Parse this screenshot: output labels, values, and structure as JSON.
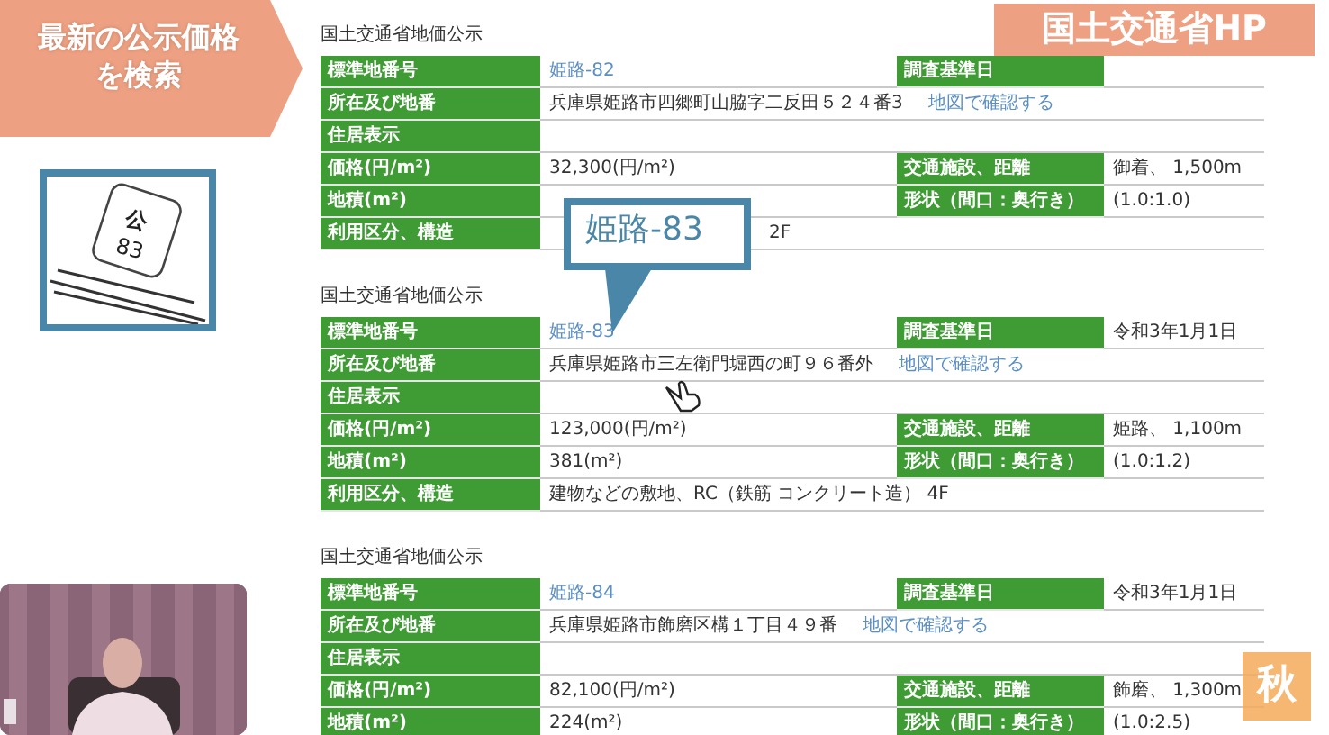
{
  "side_banner": {
    "lines": [
      "最新の公示価格",
      "を検索"
    ]
  },
  "plate_illustration": {
    "kanji": "公",
    "number": "83"
  },
  "hp_banner": "国土交通省HP",
  "callout": "姫路-83",
  "corner_badge": "秋",
  "records": [
    {
      "title": "国土交通省地価公示",
      "rows": [
        {
          "label": "標準地番号",
          "value": "姫路-82",
          "kind": "link",
          "label2": "調査基準日"
        },
        {
          "label": "所在及び地番",
          "value": "兵庫県姫路市四郷町山脇字二反田５２４番3",
          "kind": "text",
          "link": "地図で確認する"
        },
        {
          "label": "住居表示"
        },
        {
          "label": "価格(円/m²)",
          "value": "32,300(円/m²)",
          "kind": "text",
          "label2": "交通施設、距離",
          "value2": "御着、 1,500m"
        },
        {
          "label": "地積(m²)",
          "label2": "形状（間口：奥行き）",
          "value2": "(1.0:1.0)"
        },
        {
          "label": "利用区分、構造",
          "value": "2F",
          "kind": "covered"
        }
      ]
    },
    {
      "title": "国土交通省地価公示",
      "rows": [
        {
          "label": "標準地番号",
          "value": "姫路-83",
          "kind": "link",
          "label2": "調査基準日",
          "value2": "令和3年1月1日"
        },
        {
          "label": "所在及び地番",
          "value": "兵庫県姫路市三左衛門堀西の町９６番外",
          "kind": "text",
          "link": "地図で確認する"
        },
        {
          "label": "住居表示"
        },
        {
          "label": "価格(円/m²)",
          "value": "123,000(円/m²)",
          "kind": "text",
          "label2": "交通施設、距離",
          "value2": "姫路、 1,100m"
        },
        {
          "label": "地積(m²)",
          "value": "381(m²)",
          "kind": "text",
          "label2": "形状（間口：奥行き）",
          "value2": "(1.0:1.2)"
        },
        {
          "label": "利用区分、構造",
          "value": "建物などの敷地、RC（鉄筋 コンクリート造） 4F",
          "kind": "text"
        }
      ]
    },
    {
      "title": "国土交通省地価公示",
      "rows": [
        {
          "label": "標準地番号",
          "value": "姫路-84",
          "kind": "link",
          "label2": "調査基準日",
          "value2": "令和3年1月1日"
        },
        {
          "label": "所在及び地番",
          "value": "兵庫県姫路市飾磨区構１丁目４９番",
          "kind": "text",
          "link": "地図で確認する"
        },
        {
          "label": "住居表示"
        },
        {
          "label": "価格(円/m²)",
          "value": "82,100(円/m²)",
          "kind": "text",
          "label2": "交通施設、距離",
          "value2": "飾磨、 1,300m"
        },
        {
          "label": "地積(m²)",
          "value": "224(m²)",
          "kind": "text",
          "label2": "形状（間口：奥行き）",
          "value2": "(1.0:2.5)"
        }
      ]
    }
  ]
}
